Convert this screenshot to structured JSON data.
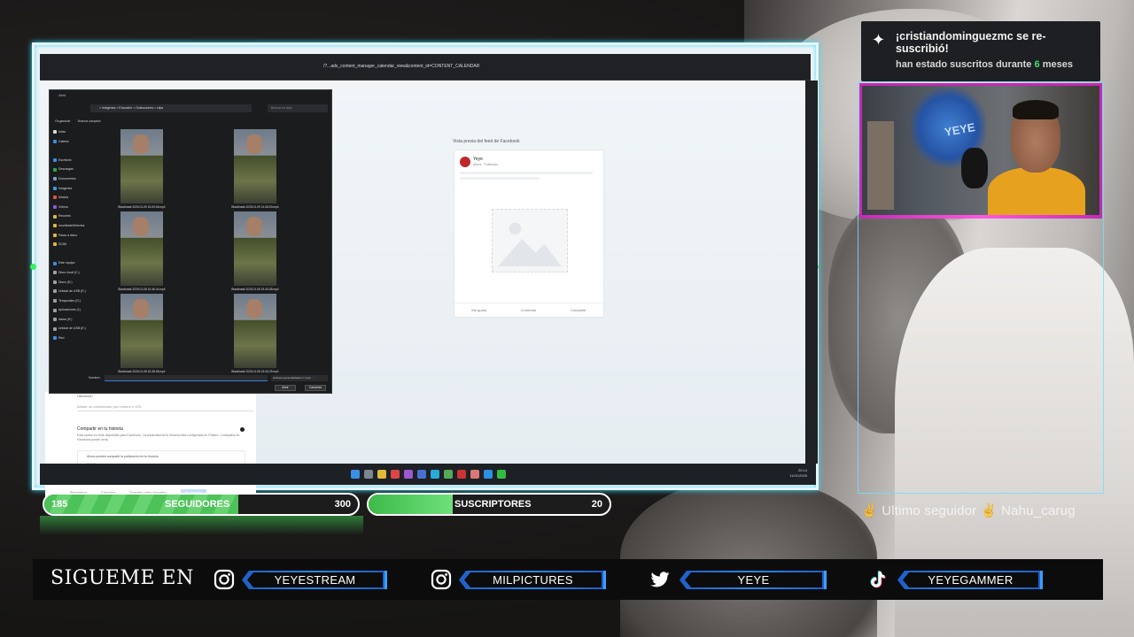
{
  "alert": {
    "title": "¡cristiandominguezmc se re-suscribió!",
    "subtitle_prefix": "han estado suscritos durante",
    "months": "6",
    "subtitle_suffix": "meses"
  },
  "last_follower": "✌ Ultimo seguidor ✌ Nahu_carug",
  "goals": {
    "followers": {
      "current": "185",
      "label": "SEGUIDORES",
      "target": "300",
      "progress": 0.62
    },
    "subscribers": {
      "current": "",
      "label": "SUSCRIPTORES",
      "target": "20",
      "progress": 0.35
    }
  },
  "social": {
    "title": "SIGUEME EN",
    "items": [
      {
        "icon": "instagram-icon",
        "handle": "YEYESTREAM"
      },
      {
        "icon": "instagram-icon",
        "handle": "MILPICTURES"
      },
      {
        "icon": "twitter-icon",
        "handle": "YEYE"
      },
      {
        "icon": "tiktok-icon",
        "handle": "YEYEGAMMER"
      }
    ]
  },
  "screen": {
    "address": "/?...ads_content_manager_calendar_view&content_id=CONTENT_CALENDAR",
    "fb_preview_title": "Vista previa del feed de Facebook",
    "fb_page_name": "Yeye",
    "fb_page_sub": "Ahora · Publicado",
    "fb_actions": [
      "Me gusta",
      "Comentar",
      "Compartir"
    ],
    "composer": {
      "section_label": "Ubicación",
      "input_placeholder": "Añade un colaborador por nombre o URL",
      "share_title": "Compartir en tu historia",
      "share_desc": "Esta opción no está disponible para Facebook. La privacidad de tu historia está configurada en Público. Cualquiera en Facebook puede verla.",
      "check_text": "Ahora puedes compartir la publicación en tu historia.",
      "check_sub": "Ver más",
      "footer": [
        "Programar",
        "Cancelar",
        "Guardar como borrador",
        "Programar"
      ]
    },
    "explorer": {
      "window_title": "Abrir",
      "path": "> Imágenes > Encuadre > Grabaciones > clips",
      "search_placeholder": "Buscar en clips",
      "toolbar": [
        "Organizar",
        "Nueva carpeta"
      ],
      "sidebar": [
        "Inicio",
        "Galería",
        "",
        "Escritorio",
        "Descargas",
        "Documentos",
        "Imágenes",
        "Música",
        "Vídeos",
        "Recortes",
        "mochiladeSelectos",
        "Pasar a disco",
        "DCIM",
        "",
        "Este equipo",
        "Disco local (C:)",
        "Disco (D:)",
        "Unidad de USB (E:)",
        "Temporales (G:)",
        "Aplicaciones (I:)",
        "datos (H:)",
        "Unidad de USB (E:)",
        "Red"
      ],
      "files": [
        "Blackhawk 2025-01-09 15-09-56.mp4",
        "Blackhawk 2025-01-09 14-08-53.mp4",
        "Blackhawk 2025-01-08 15-46-44.mp4",
        "Blackhawk 2025-01-08 15-45-58.mp4",
        "Blackhawk 2025-01-08 15-38-58.mp4",
        "Blackhawk 2025-01-08 15-05-25.mp4"
      ],
      "name_label": "Nombre:",
      "filter": "Archivos personalizados (*.mp4;...",
      "open_btn": "Abrir",
      "cancel_btn": "Cancelar"
    },
    "clock_time": "20:14",
    "clock_date": "11/01/2025"
  },
  "colors": {
    "accent_green": "#3dba4a",
    "frame_glow": "#35e0ff",
    "cam_border": "#c42ab7",
    "social_blue": "#2b88f0"
  }
}
